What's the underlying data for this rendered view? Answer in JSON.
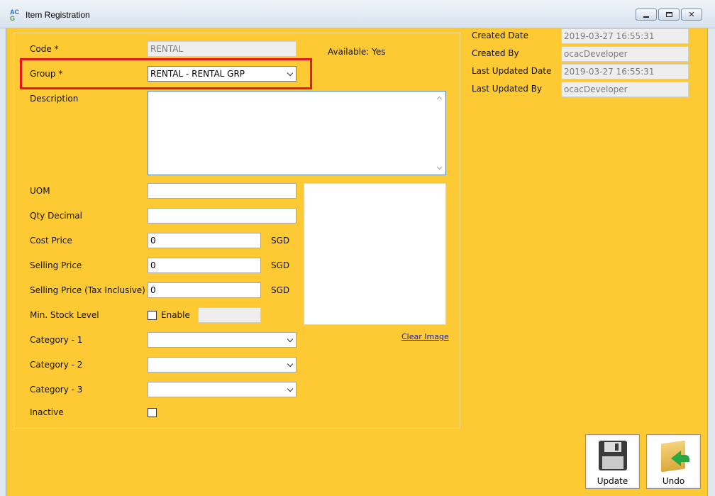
{
  "window": {
    "icon_text_top": "AC",
    "icon_text_bottom": "G",
    "title": "Item Registration"
  },
  "form": {
    "code_label": "Code *",
    "code_value": "RENTAL",
    "available_text": "Available: Yes",
    "group_label": "Group *",
    "group_value": "RENTAL - RENTAL GRP",
    "description_label": "Description",
    "description_value": "",
    "uom_label": "UOM",
    "uom_value": "",
    "qty_decimal_label": "Qty Decimal",
    "qty_decimal_value": "",
    "cost_price_label": "Cost Price",
    "cost_price_value": "0",
    "cost_price_currency": "SGD",
    "selling_price_label": "Selling Price",
    "selling_price_value": "0",
    "selling_price_currency": "SGD",
    "selling_price_tax_label": "Selling Price (Tax Inclusive)",
    "selling_price_tax_value": "0",
    "selling_price_tax_currency": "SGD",
    "min_stock_label": "Min. Stock Level",
    "min_stock_enable_label": "Enable",
    "min_stock_enabled": false,
    "min_stock_value": "",
    "category1_label": "Category - 1",
    "category1_value": "",
    "category2_label": "Category - 2",
    "category2_value": "",
    "category3_label": "Category - 3",
    "category3_value": "",
    "inactive_label": "Inactive",
    "inactive_checked": false,
    "clear_image_label": "Clear Image"
  },
  "audit": {
    "created_date_label": "Created Date",
    "created_date_value": "2019-03-27 16:55:31",
    "created_by_label": "Created By",
    "created_by_value": "ocacDeveloper",
    "last_updated_date_label": "Last Updated Date",
    "last_updated_date_value": "2019-03-27 16:55:31",
    "last_updated_by_label": "Last Updated By",
    "last_updated_by_value": "ocacDeveloper"
  },
  "toolbar": {
    "update_label": "Update",
    "undo_label": "Undo"
  },
  "icons": {
    "update": "floppy-disk-icon",
    "undo": "folder-undo-icon"
  },
  "colors": {
    "form_background": "#fdca34",
    "highlight_border": "#e5171c",
    "link": "#1a1aa8"
  }
}
